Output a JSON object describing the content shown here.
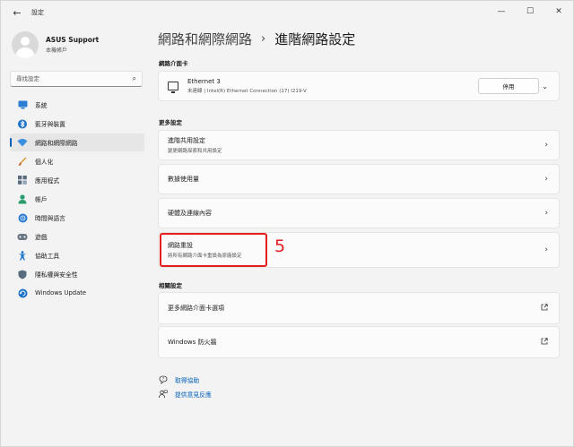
{
  "window": {
    "title": "設定",
    "controls": {
      "minimize": "—",
      "maximize": "☐",
      "close": "✕"
    }
  },
  "profile": {
    "name": "ASUS Support",
    "account_type": "本機帳戶"
  },
  "search": {
    "placeholder": "尋找設定"
  },
  "sidebar": {
    "items": [
      {
        "label": "系統",
        "icon": "monitor-icon",
        "active": false
      },
      {
        "label": "藍牙與裝置",
        "icon": "bluetooth-icon",
        "active": false
      },
      {
        "label": "網路和網際網路",
        "icon": "wifi-icon",
        "active": true
      },
      {
        "label": "個人化",
        "icon": "brush-icon",
        "active": false
      },
      {
        "label": "應用程式",
        "icon": "apps-icon",
        "active": false
      },
      {
        "label": "帳戶",
        "icon": "person-icon",
        "active": false
      },
      {
        "label": "時間與語言",
        "icon": "globe-clock-icon",
        "active": false
      },
      {
        "label": "遊戲",
        "icon": "gamepad-icon",
        "active": false
      },
      {
        "label": "協助工具",
        "icon": "accessibility-icon",
        "active": false
      },
      {
        "label": "隱私權與安全性",
        "icon": "shield-icon",
        "active": false
      },
      {
        "label": "Windows Update",
        "icon": "update-icon",
        "active": false
      }
    ]
  },
  "breadcrumb": {
    "parent": "網路和網際網路",
    "separator": "›",
    "current": "進階網路設定"
  },
  "sections": {
    "adapters": "網路介面卡",
    "more_settings": "更多設定",
    "related_settings": "相關設定"
  },
  "adapter": {
    "name": "Ethernet 3",
    "description": "未連線 | Intel(R) Ethernet Connection (17) I219-V",
    "disable_label": "停用"
  },
  "more_settings": [
    {
      "title": "進階共用設定",
      "subtitle": "變更網路探索和共用設定"
    },
    {
      "title": "數據使用量",
      "subtitle": ""
    },
    {
      "title": "硬體及連線內容",
      "subtitle": ""
    },
    {
      "title": "網路重設",
      "subtitle": "將所有網路介面卡重設為原廠設定"
    }
  ],
  "related_settings": [
    {
      "title": "更多網路介面卡選項"
    },
    {
      "title": "Windows 防火牆"
    }
  ],
  "annotation": {
    "step": "5",
    "color": "#e41d1d"
  },
  "help": {
    "get_help": "取得協助",
    "feedback": "提供意見反應"
  },
  "colors": {
    "accent": "#005fb8",
    "background": "#f3f3f3",
    "card": "#fbfbfb"
  }
}
